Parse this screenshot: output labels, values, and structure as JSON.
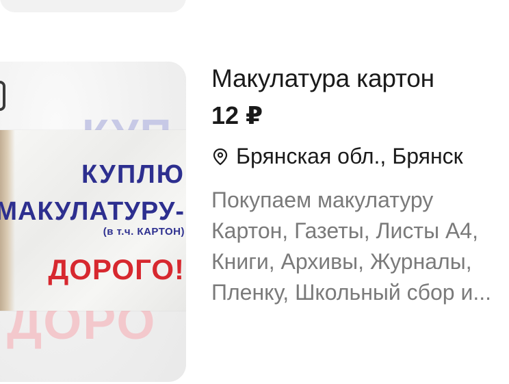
{
  "listing": {
    "title": "Макулатура картон",
    "price": "12 ₽",
    "location": "Брянская обл., Брянск",
    "location_icon": "map-pin-icon",
    "description_lines": [
      "Покупаем макулатуру",
      "Картон, Газеты, Листы А4,",
      "Книги, Архивы, Журналы,",
      "Пленку, Школьный сбор и..."
    ],
    "image": {
      "lines": [
        "КУПЛЮ",
        "МАКУЛАТУРУ-",
        "(в т.ч. КАРТОН)",
        "ДОРОГО!"
      ],
      "primary_color": "#2d2f8f",
      "accent_color": "#d7282f"
    }
  },
  "colors": {
    "title": "#1a1a1a",
    "description": "#7a7a7a",
    "background": "#ffffff"
  }
}
